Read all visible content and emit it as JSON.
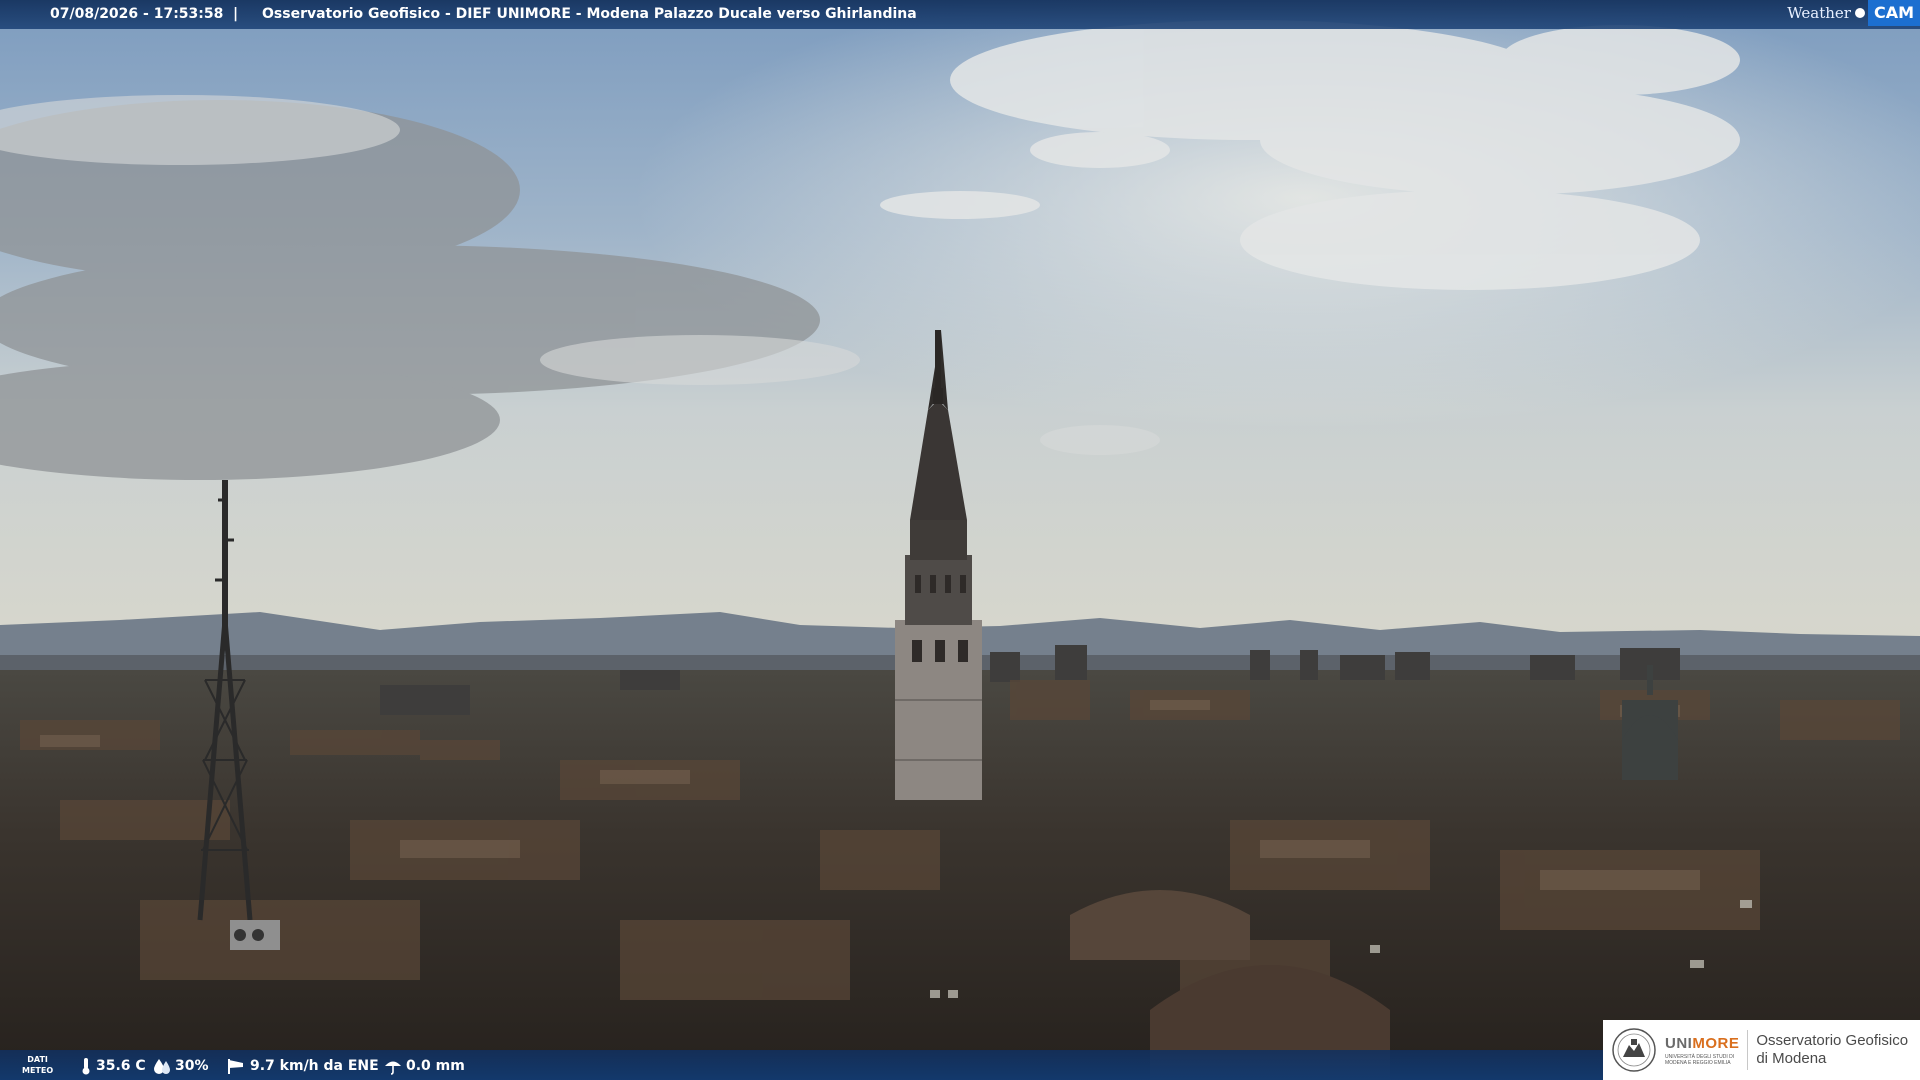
{
  "overlay": {
    "timestamp": "07/08/2026 - 17:53:58",
    "separator": "|",
    "camera_title": "Osservatorio Geofisico - DIEF UNIMORE - Modena Palazzo Ducale verso Ghirlandina"
  },
  "weathercam_logo": {
    "word": "Weather",
    "cam": "CAM"
  },
  "meteo": {
    "label_line1": "DATI",
    "label_line2": "METEO",
    "temperature": "35.6 C",
    "humidity": "30%",
    "wind": "9.7 km/h da ENE",
    "rain": "0.0 mm",
    "icons": [
      "thermometer-icon",
      "humidity-drop-icon",
      "wind-sock-icon",
      "umbrella-icon"
    ]
  },
  "unimore_logo": {
    "name_part1": "UNI",
    "name_part2": "MORE",
    "subtitle_line1": "UNIVERSITÀ DEGLI STUDI DI",
    "subtitle_line2": "MODENA E REGGIO EMILIA",
    "observatory_line1": "Osservatorio Geofisico",
    "observatory_line2": "di Modena"
  },
  "colors": {
    "bar_blue": "#1c4276",
    "unimore_orange": "#d96f1e",
    "weathercam_blue": "#1c6fd0"
  }
}
